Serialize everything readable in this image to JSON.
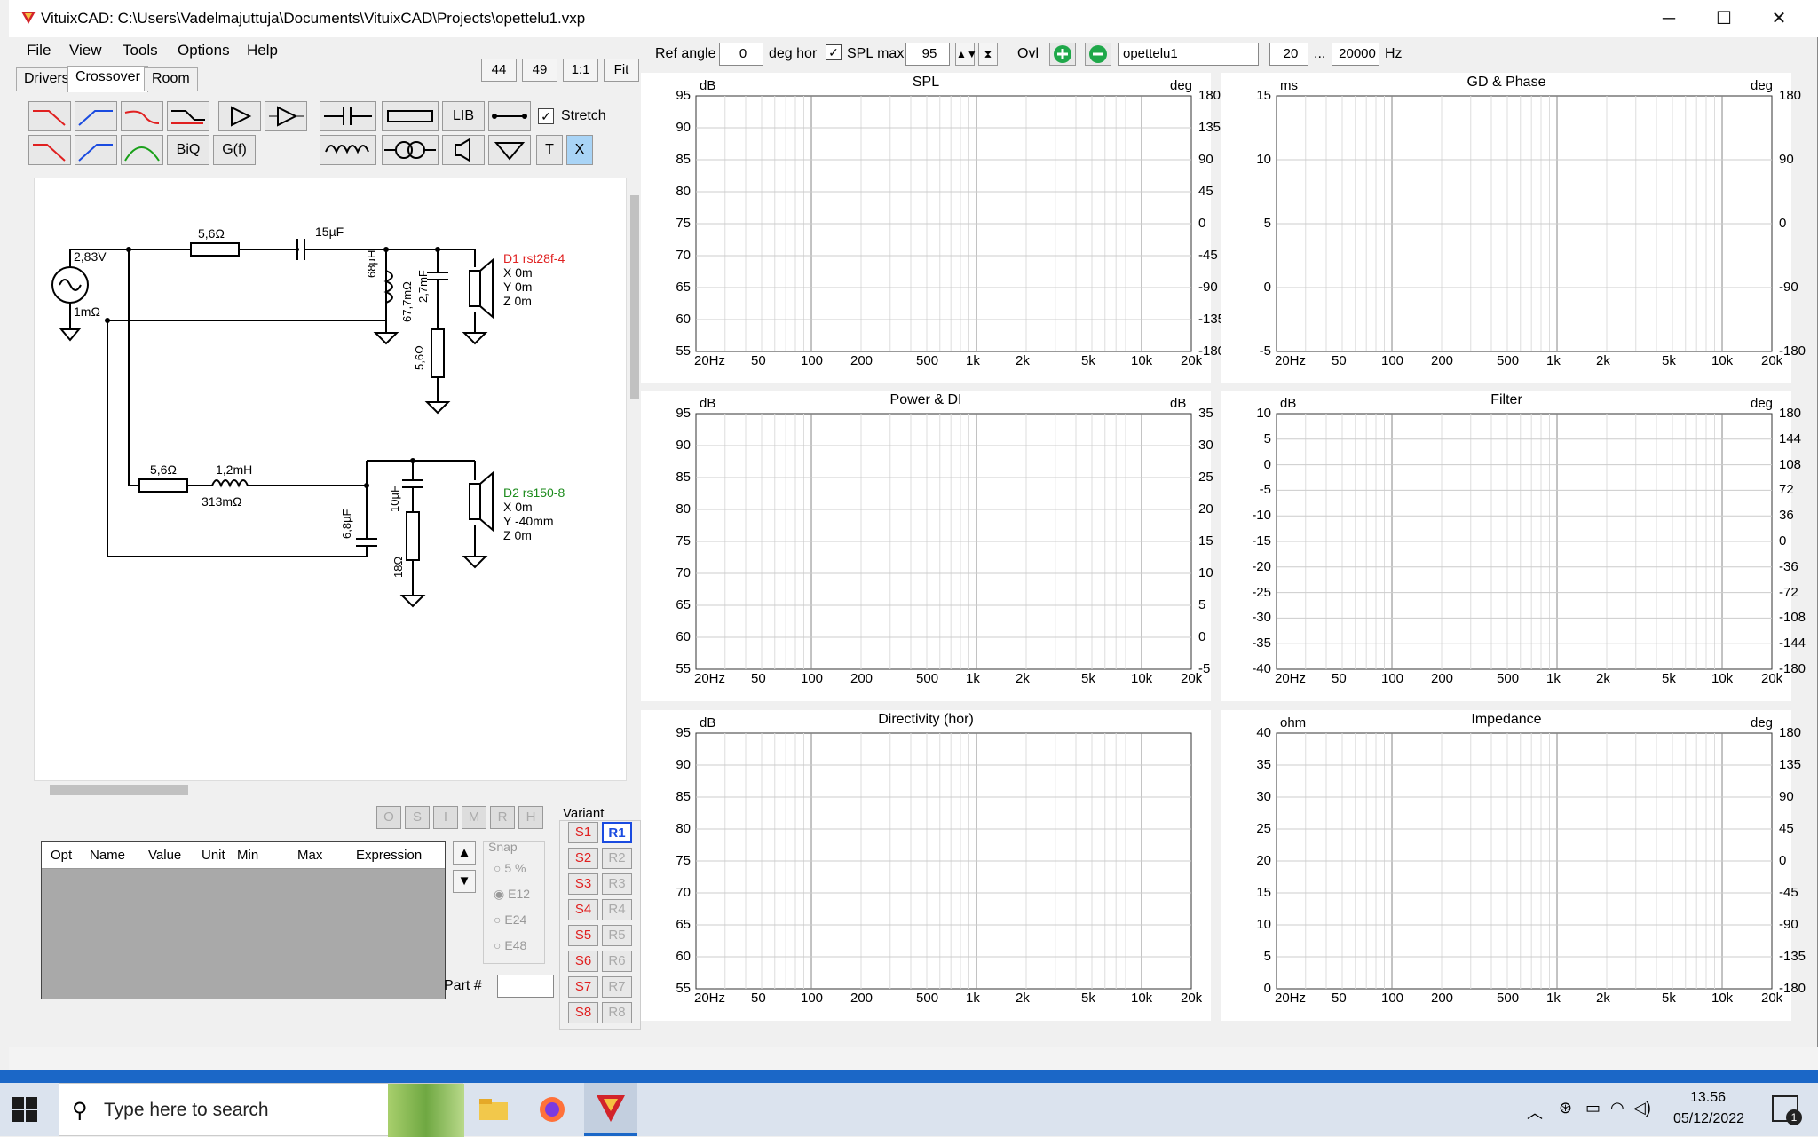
{
  "window": {
    "title": "VituixCAD: C:\\Users\\Vadelmajuttuja\\Documents\\VituixCAD\\Projects\\opettelu1.vxp"
  },
  "menu": [
    "File",
    "View",
    "Tools",
    "Options",
    "Help"
  ],
  "tabs": [
    "Drivers",
    "Crossover",
    "Room"
  ],
  "size_buttons": [
    "44",
    "49",
    "1:1",
    "Fit"
  ],
  "toolbar": {
    "lib": "LIB",
    "stretch_label": "Stretch",
    "biq": "BiQ",
    "gf": "G(f)",
    "t": "T",
    "x": "X"
  },
  "topbar": {
    "ref_angle_label": "Ref angle",
    "ref_angle_value": "0",
    "deg_hor": "deg hor",
    "spl_max_label": "SPL max",
    "spl_max_value": "95",
    "ovl": "Ovl",
    "project_name": "opettelu1",
    "freq_min": "20",
    "ellipsis": "...",
    "freq_max": "20000",
    "hz": "Hz"
  },
  "schematic": {
    "source_voltage": "2,83V",
    "source_res": "1mΩ",
    "r1": "5,6Ω",
    "c1": "15µF",
    "l1": "68µH",
    "l1_res": "67,7mΩ",
    "c2": "2,7mF",
    "r2": "5,6Ω",
    "d1_name": "D1 rst28f-4",
    "d1_x": "X 0m",
    "d1_y": "Y 0m",
    "d1_z": "Z 0m",
    "r3": "5,6Ω",
    "l2": "1,2mH",
    "l2_res": "313mΩ",
    "c3": "6,8µF",
    "c4": "10µF",
    "r4": "18Ω",
    "d2_name": "D2 rs150-8",
    "d2_x": "X 0m",
    "d2_y": "Y -40mm",
    "d2_z": "Z 0m"
  },
  "opt_buttons": [
    "O",
    "S",
    "I",
    "M",
    "R",
    "H"
  ],
  "table": {
    "columns": [
      "Opt",
      "Name",
      "Value",
      "Unit",
      "Min",
      "Max",
      "Expression"
    ]
  },
  "snap": {
    "label": "Snap",
    "options": [
      "5 %",
      "E12",
      "E24",
      "E48"
    ],
    "selected": "E12"
  },
  "part_label": "Part #",
  "variant": {
    "label": "Variant",
    "s": [
      "S1",
      "S2",
      "S3",
      "S4",
      "S5",
      "S6",
      "S7",
      "S8"
    ],
    "r": [
      "R1",
      "R2",
      "R3",
      "R4",
      "R5",
      "R6",
      "R7",
      "R8"
    ],
    "active_r": "R1"
  },
  "graphs": {
    "spl": {
      "title": "SPL",
      "left_unit": "dB",
      "right_unit": "deg",
      "y": [
        "95",
        "90",
        "85",
        "80",
        "75",
        "70",
        "65",
        "60",
        "55"
      ],
      "y2": [
        "180",
        "135",
        "90",
        "45",
        "0",
        "-45",
        "-90",
        "-135",
        "-180"
      ]
    },
    "gd": {
      "title": "GD & Phase",
      "left_unit": "ms",
      "right_unit": "deg",
      "y": [
        "15",
        "10",
        "5",
        "0",
        "-5"
      ],
      "y2": [
        "180",
        "90",
        "0",
        "-90",
        "-180"
      ]
    },
    "power": {
      "title": "Power & DI",
      "left_unit": "dB",
      "right_unit": "dB",
      "y": [
        "95",
        "90",
        "85",
        "80",
        "75",
        "70",
        "65",
        "60",
        "55"
      ],
      "y2": [
        "35",
        "30",
        "25",
        "20",
        "15",
        "10",
        "5",
        "0",
        "-5"
      ]
    },
    "filter": {
      "title": "Filter",
      "left_unit": "dB",
      "right_unit": "deg",
      "y": [
        "10",
        "5",
        "0",
        "-5",
        "-10",
        "-15",
        "-20",
        "-25",
        "-30",
        "-35",
        "-40"
      ],
      "y2": [
        "180",
        "144",
        "108",
        "72",
        "36",
        "0",
        "-36",
        "-72",
        "-108",
        "-144",
        "-180"
      ]
    },
    "dir": {
      "title": "Directivity (hor)",
      "left_unit": "dB",
      "y": [
        "95",
        "90",
        "85",
        "80",
        "75",
        "70",
        "65",
        "60",
        "55"
      ]
    },
    "imp": {
      "title": "Impedance",
      "left_unit": "ohm",
      "right_unit": "deg",
      "y": [
        "40",
        "35",
        "30",
        "25",
        "20",
        "15",
        "10",
        "5",
        "0"
      ],
      "y2": [
        "180",
        "135",
        "90",
        "45",
        "0",
        "-45",
        "-90",
        "-135",
        "-180"
      ]
    },
    "x_ticks": [
      "20Hz",
      "50",
      "100",
      "200",
      "500",
      "1k",
      "2k",
      "5k",
      "10k",
      "20k"
    ]
  },
  "taskbar": {
    "search_placeholder": "Type here to search",
    "time": "13.56",
    "date": "05/12/2022",
    "notif_count": "1"
  }
}
